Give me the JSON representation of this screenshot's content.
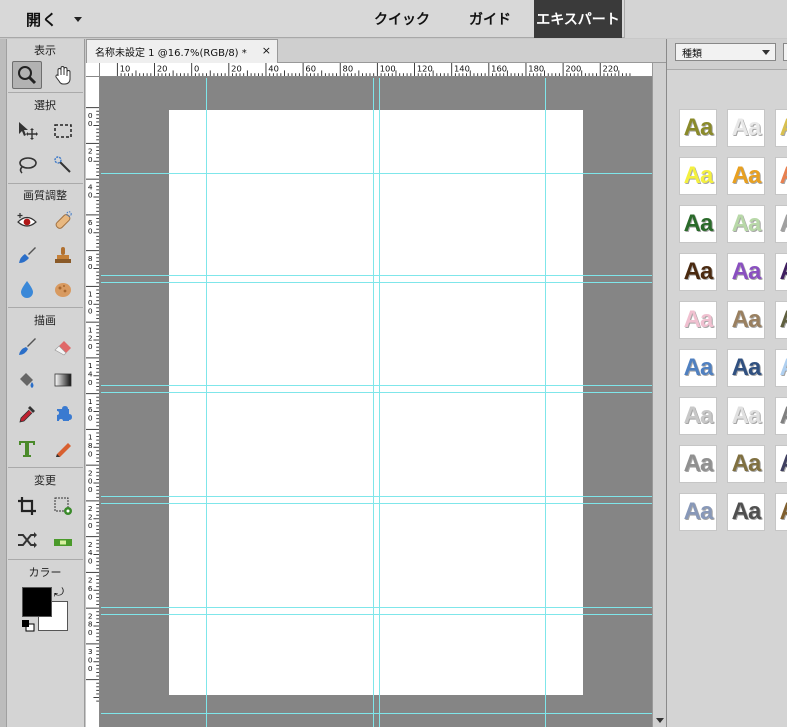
{
  "topbar": {
    "open_label": "開く",
    "modes": [
      "クイック",
      "ガイド",
      "エキスパート"
    ],
    "active_mode": "エキスパート"
  },
  "toolbox": {
    "sections": {
      "view": "表示",
      "select": "選択",
      "enhance": "画質調整",
      "draw": "描画",
      "modify": "変更",
      "color": "カラー"
    },
    "tools": [
      {
        "name": "zoom-tool",
        "icon": "magnifier-icon",
        "active": true
      },
      {
        "name": "hand-tool",
        "icon": "hand-icon"
      },
      {
        "name": "move-tool",
        "icon": "move-arrow-icon"
      },
      {
        "name": "marquee-tool",
        "icon": "dashed-rectangle-icon"
      },
      {
        "name": "lasso-tool",
        "icon": "lasso-icon"
      },
      {
        "name": "quick-selection-tool",
        "icon": "magic-wand-icon"
      },
      {
        "name": "red-eye-tool",
        "icon": "eye-icon"
      },
      {
        "name": "spot-healing-tool",
        "icon": "bandage-icon"
      },
      {
        "name": "smart-brush-tool",
        "icon": "brush-icon"
      },
      {
        "name": "clone-stamp-tool",
        "icon": "stamp-icon"
      },
      {
        "name": "blur-tool",
        "icon": "water-drop-icon"
      },
      {
        "name": "sponge-tool",
        "icon": "sponge-icon"
      },
      {
        "name": "brush-tool",
        "icon": "paintbrush-icon"
      },
      {
        "name": "eraser-tool",
        "icon": "eraser-icon"
      },
      {
        "name": "paint-bucket-tool",
        "icon": "bucket-icon"
      },
      {
        "name": "gradient-tool",
        "icon": "gradient-icon"
      },
      {
        "name": "eyedropper-tool",
        "icon": "eyedropper-icon"
      },
      {
        "name": "custom-shape-tool",
        "icon": "puzzle-shape-icon"
      },
      {
        "name": "type-tool",
        "icon": "letter-t-icon"
      },
      {
        "name": "pencil-tool",
        "icon": "pencil-icon"
      },
      {
        "name": "crop-tool",
        "icon": "crop-icon"
      },
      {
        "name": "recompose-tool",
        "icon": "recompose-icon"
      },
      {
        "name": "content-aware-move-tool",
        "icon": "shuffle-arrows-icon"
      },
      {
        "name": "straighten-tool",
        "icon": "level-icon"
      }
    ],
    "colors": {
      "foreground": "#000000",
      "background": "#ffffff"
    }
  },
  "document": {
    "tab_title": "名称未設定 1 @16.7%(RGB/8) *",
    "close_glyph": "×",
    "h_ruler_labels": [
      "10",
      "20",
      "0",
      "20",
      "40",
      "60",
      "80",
      "100",
      "120",
      "140",
      "160",
      "180",
      "200",
      "220"
    ],
    "v_ruler_labels": [
      "0",
      "2",
      "4",
      "6",
      "8",
      "10",
      "12",
      "14",
      "16",
      "18",
      "20",
      "22",
      "24",
      "26",
      "28",
      "30"
    ],
    "guide_color": "#7fe6ea",
    "canvas_color": "#858585",
    "page_color": "#ffffff"
  },
  "panel": {
    "dropdown_label": "種類",
    "tile_text": "Aa",
    "styles": [
      [
        "#8a8a2a",
        "#e8e8e8",
        "#d8c050"
      ],
      [
        "#f4f040",
        "#e8a020",
        "#e88050"
      ],
      [
        "#2a6a2a",
        "#b8d8a8",
        "#a0a0a0"
      ],
      [
        "#4a2a10",
        "#8a50c0",
        "#402060"
      ],
      [
        "#f0c0d0",
        "#9a8060",
        "#606040"
      ],
      [
        "#5080c0",
        "#305080",
        "#b0d0f0"
      ],
      [
        "#c8c8c8",
        "#e0e0e0",
        "#808080"
      ],
      [
        "#909090",
        "#807040",
        "#404060"
      ],
      [
        "#8898b8",
        "#505050",
        "#806030"
      ]
    ]
  }
}
